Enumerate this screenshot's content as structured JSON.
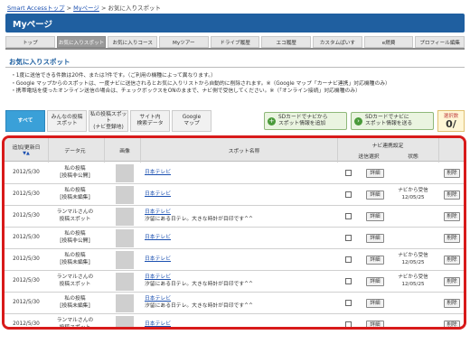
{
  "breadcrumb": {
    "home": "Smart Accessトップ",
    "sep1": ">",
    "mypage": "Myページ",
    "sep2": ">",
    "current": "お気に入りスポット"
  },
  "header": {
    "title": "Myページ"
  },
  "tabs": [
    {
      "label": "トップ",
      "active": false
    },
    {
      "label": "お気に入りスポット",
      "active": true
    },
    {
      "label": "お気に入りコース",
      "active": false
    },
    {
      "label": "Myツアー",
      "active": false
    },
    {
      "label": "ドライブ履歴",
      "active": false
    },
    {
      "label": "エコ履歴",
      "active": false
    },
    {
      "label": "カスタムぱいす",
      "active": false
    },
    {
      "label": "e燃費",
      "active": false
    },
    {
      "label": "プロフィール編集",
      "active": false
    }
  ],
  "section": {
    "title": "お気に入りスポット"
  },
  "notices": [
    "・1度に送信できる件数は20件、または?件です。（ご利用の機種によって異なります。）",
    "・Google マップからのスポットは、一度ナビに送信されるとお気に入りリストから自動的に削除されます。※（Google マップ「カーナビ連携」対応機種のみ）",
    "・携帯電話を使ったオンライン送信の場合は、チェックボックスをONのままで、ナビ側で受信してください。※（「オンライン接続」対応機種のみ）"
  ],
  "filters": [
    {
      "label": "すべて",
      "active": true
    },
    {
      "label": "みんなの投稿\nスポット",
      "active": false
    },
    {
      "label": "私の投稿スポット\n(ナビ登録地)",
      "active": false
    },
    {
      "label": "サイト内\n検索データ",
      "active": false
    },
    {
      "label": "Google\nマップ",
      "active": false
    }
  ],
  "sd": {
    "add_label": "SDカードでナビから\nスポット情報を追加",
    "send_label": "SDカードでナビに\nスポット情報を送る"
  },
  "selected": {
    "label": "選択数",
    "count": "0/"
  },
  "table": {
    "headers": {
      "date": "追加/更新日",
      "sort_marks": "▼▲",
      "source": "データ元",
      "image": "画像",
      "name": "スポット名称",
      "navi_group": "ナビ連携設定",
      "send_select": "送信選択",
      "status": "状態"
    },
    "detail_label": "詳細",
    "delete_label": "削除",
    "rows": [
      {
        "date": "2012/5/30",
        "source1": "私の投稿",
        "source2": "[投稿非公開]",
        "name": "日本テレビ",
        "desc": "",
        "status1": "",
        "status2": ""
      },
      {
        "date": "2012/5/30",
        "source1": "私の投稿",
        "source2": "[投稿未編集]",
        "name": "日本テレビ",
        "desc": "",
        "status1": "ナビから受信",
        "status2": "12/05/25"
      },
      {
        "date": "2012/5/30",
        "source1": "ランマルさんの",
        "source2": "投稿スポット",
        "name": "日本テレビ",
        "desc": "汐留にある日テレ。大きな時計が目印です^^",
        "status1": "",
        "status2": ""
      },
      {
        "date": "2012/5/30",
        "source1": "私の投稿",
        "source2": "[投稿非公開]",
        "name": "日本テレビ",
        "desc": "",
        "status1": "",
        "status2": ""
      },
      {
        "date": "2012/5/30",
        "source1": "私の投稿",
        "source2": "[投稿未編集]",
        "name": "日本テレビ",
        "desc": "",
        "status1": "ナビから受信",
        "status2": "12/05/25"
      },
      {
        "date": "2012/5/30",
        "source1": "ランマルさんの",
        "source2": "投稿スポット",
        "name": "日本テレビ",
        "desc": "汐留にある日テレ。大きな時計が目印です^^",
        "status1": "ナビから受信",
        "status2": "12/05/25"
      },
      {
        "date": "2012/5/30",
        "source1": "私の投稿",
        "source2": "[投稿未編集]",
        "name": "日本テレビ",
        "desc": "汐留にある日テレ。大きな時計が目印です^^",
        "status1": "",
        "status2": ""
      },
      {
        "date": "2012/5/30",
        "source1": "ランマルさんの",
        "source2": "投稿スポット",
        "name": "日本テレビ",
        "desc": "",
        "status1": "",
        "status2": ""
      }
    ]
  },
  "colors": {
    "header_blue": "#1f5fa0",
    "active_filter": "#3aa0d8",
    "highlight_border": "#d81a1a",
    "link": "#1a4fb0"
  }
}
